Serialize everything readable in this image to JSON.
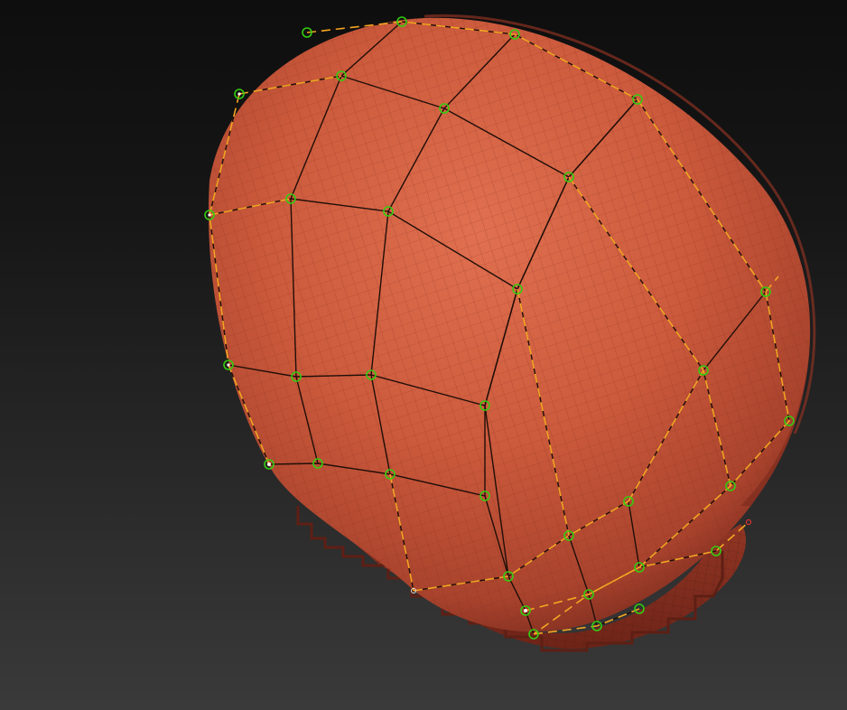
{
  "viewport": {
    "background_top": "#0e0e0e",
    "background_bottom": "#3a3a3a"
  },
  "mesh": {
    "base_color": "#c9583a",
    "highlight_color": "#e2704d",
    "shadow_color": "#7a2a1e",
    "curve_color_primary": "#f0a020",
    "curve_color_secondary": "#1a0e08",
    "control_point_color": "#33cc11",
    "control_point_selected_color": "#ffffff"
  }
}
